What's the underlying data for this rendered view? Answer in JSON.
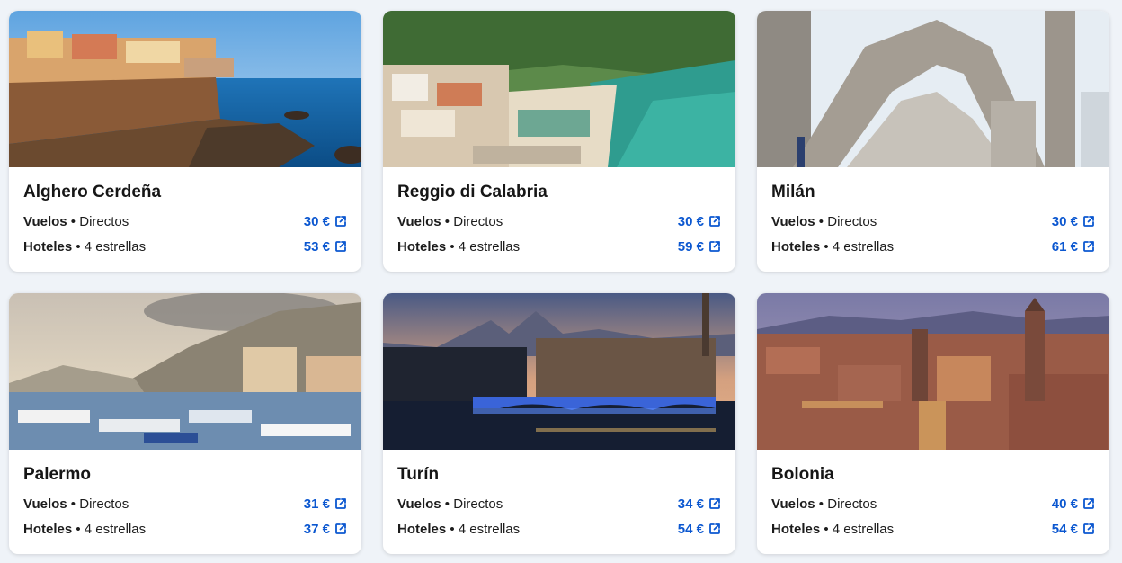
{
  "accent": "#0b57d0",
  "cards": [
    {
      "name": "Alghero Cerdeña",
      "flights_label": "Vuelos",
      "flights_type": "Directos",
      "flights_price": "30 €",
      "hotels_label": "Hoteles",
      "hotels_type": "4 estrellas",
      "hotels_price": "53 €",
      "icon": "external-link-icon"
    },
    {
      "name": "Reggio di Calabria",
      "flights_label": "Vuelos",
      "flights_type": "Directos",
      "flights_price": "30 €",
      "hotels_label": "Hoteles",
      "hotels_type": "4 estrellas",
      "hotels_price": "59 €",
      "icon": "external-link-icon"
    },
    {
      "name": "Milán",
      "flights_label": "Vuelos",
      "flights_type": "Directos",
      "flights_price": "30 €",
      "hotels_label": "Hoteles",
      "hotels_type": "4 estrellas",
      "hotels_price": "61 €",
      "icon": "external-link-icon"
    },
    {
      "name": "Palermo",
      "flights_label": "Vuelos",
      "flights_type": "Directos",
      "flights_price": "31 €",
      "hotels_label": "Hoteles",
      "hotels_type": "4 estrellas",
      "hotels_price": "37 €",
      "icon": "external-link-icon"
    },
    {
      "name": "Turín",
      "flights_label": "Vuelos",
      "flights_type": "Directos",
      "flights_price": "34 €",
      "hotels_label": "Hoteles",
      "hotels_type": "4 estrellas",
      "hotels_price": "54 €",
      "icon": "external-link-icon"
    },
    {
      "name": "Bolonia",
      "flights_label": "Vuelos",
      "flights_type": "Directos",
      "flights_price": "40 €",
      "hotels_label": "Hoteles",
      "hotels_type": "4 estrellas",
      "hotels_price": "54 €",
      "icon": "external-link-icon"
    }
  ]
}
